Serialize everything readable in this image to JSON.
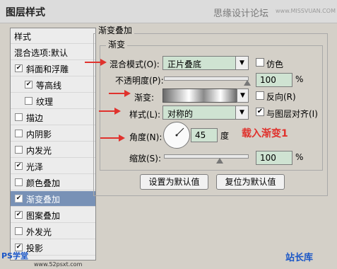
{
  "window": {
    "title": "图层样式",
    "watermark": "思缘设计论坛",
    "watermark_url": "www.MISSVUAN.COM"
  },
  "style_list": {
    "items": [
      {
        "label": "样式",
        "checkbox": false,
        "checked": false,
        "selected": false
      },
      {
        "label": "混合选项:默认",
        "checkbox": false,
        "checked": false,
        "selected": false
      },
      {
        "label": "斜面和浮雕",
        "checkbox": true,
        "checked": true,
        "selected": false
      },
      {
        "label": "等高线",
        "checkbox": true,
        "checked": true,
        "selected": false
      },
      {
        "label": "纹理",
        "checkbox": true,
        "checked": false,
        "selected": false
      },
      {
        "label": "描边",
        "checkbox": true,
        "checked": false,
        "selected": false
      },
      {
        "label": "内阴影",
        "checkbox": true,
        "checked": false,
        "selected": false
      },
      {
        "label": "内发光",
        "checkbox": true,
        "checked": false,
        "selected": false
      },
      {
        "label": "光泽",
        "checkbox": true,
        "checked": true,
        "selected": false
      },
      {
        "label": "颜色叠加",
        "checkbox": true,
        "checked": false,
        "selected": false
      },
      {
        "label": "渐变叠加",
        "checkbox": true,
        "checked": true,
        "selected": true
      },
      {
        "label": "图案叠加",
        "checkbox": true,
        "checked": true,
        "selected": false
      },
      {
        "label": "外发光",
        "checkbox": true,
        "checked": false,
        "selected": false
      },
      {
        "label": "投影",
        "checkbox": true,
        "checked": true,
        "selected": false
      }
    ]
  },
  "panel": {
    "group_title": "渐变叠加",
    "sub_title": "渐变",
    "blend_mode": {
      "label": "混合模式(O):",
      "value": "正片叠底"
    },
    "dither": {
      "label": "仿色",
      "checked": false
    },
    "opacity": {
      "label": "不透明度(P):",
      "value": "100",
      "unit": "%",
      "level": 1.0
    },
    "gradient": {
      "label": "渐变:"
    },
    "reverse": {
      "label": "反向(R)",
      "checked": false
    },
    "style": {
      "label": "样式(L):",
      "value": "对称的"
    },
    "align": {
      "label": "与图层对齐(I)",
      "checked": true
    },
    "angle": {
      "label": "角度(N):",
      "value": "45",
      "unit": "度"
    },
    "scale": {
      "label": "缩放(S):",
      "value": "100",
      "unit": "%",
      "level": 0.67
    },
    "btn_default": "设置为默认值",
    "btn_reset": "复位为默认值"
  },
  "annotation": "载入渐变1",
  "footer": {
    "left": "PS学堂",
    "left_url": "www.52psxt.com",
    "right": "站长库"
  },
  "colors": {
    "accent_red": "#e0322d",
    "field_green": "#cfe3d2",
    "selected_row": "#7891b6"
  }
}
